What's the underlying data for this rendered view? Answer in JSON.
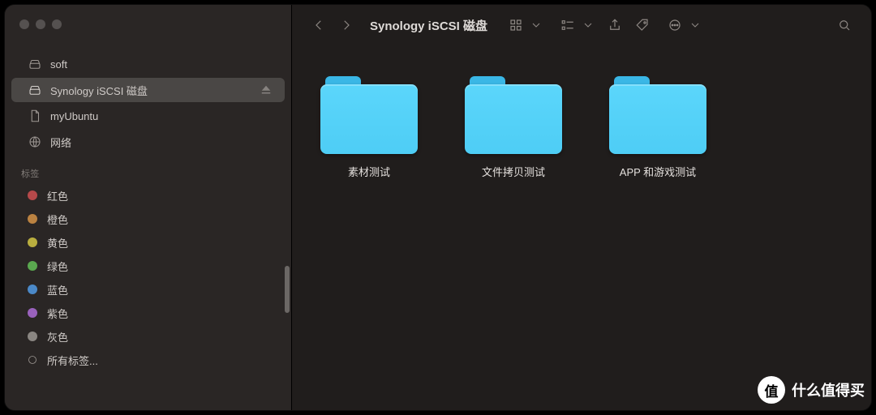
{
  "window": {
    "title": "Synology iSCSI 磁盘"
  },
  "sidebar": {
    "items": [
      {
        "name": "soft",
        "icon": "disk"
      },
      {
        "name": "Synology iSCSI 磁盘",
        "icon": "disk",
        "selected": true,
        "ejectable": true
      },
      {
        "name": "myUbuntu",
        "icon": "document"
      },
      {
        "name": "网络",
        "icon": "globe"
      }
    ],
    "tags_label": "标签",
    "tags": [
      {
        "label": "红色",
        "color": "#b6494a"
      },
      {
        "label": "橙色",
        "color": "#bb8241"
      },
      {
        "label": "黄色",
        "color": "#b9ae3f"
      },
      {
        "label": "绿色",
        "color": "#5aa84f"
      },
      {
        "label": "蓝色",
        "color": "#4b89c8"
      },
      {
        "label": "紫色",
        "color": "#9a62bd"
      },
      {
        "label": "灰色",
        "color": "#8a8682"
      }
    ],
    "all_tags_label": "所有标签..."
  },
  "folders": [
    {
      "label": "素材测试"
    },
    {
      "label": "文件拷贝测试"
    },
    {
      "label": "APP 和游戏测试"
    }
  ],
  "watermark": {
    "badge": "值",
    "text": "什么值得买"
  }
}
